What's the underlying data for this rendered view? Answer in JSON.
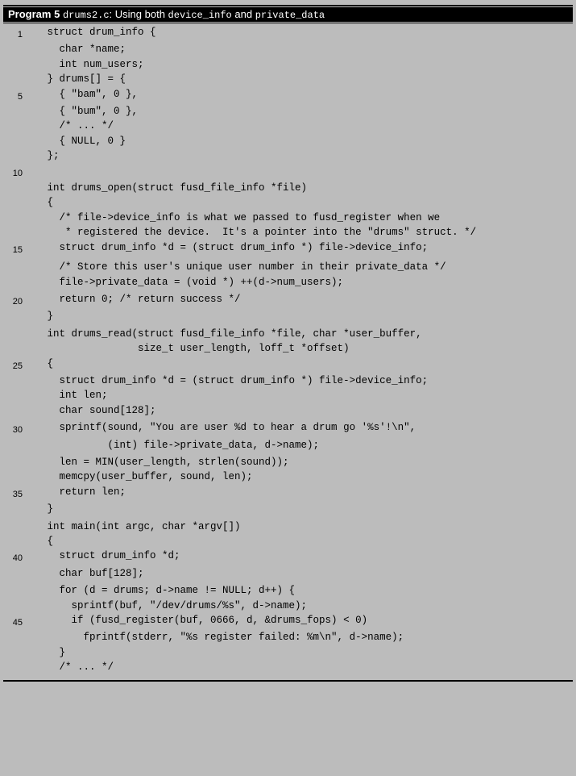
{
  "header": {
    "program_label": "Program 5",
    "filename": "drums2.c",
    "description_prefix": ": Using both ",
    "term1": "device_info",
    "description_mid": " and ",
    "term2": "private_data"
  },
  "code_lines": [
    {
      "num": "1",
      "text": "   struct drum_info {"
    },
    {
      "num": "",
      "text": "     char *name;"
    },
    {
      "num": "",
      "text": "     int num_users;"
    },
    {
      "num": "",
      "text": "   } drums[] = {"
    },
    {
      "num": "5",
      "text": "     { \"bam\", 0 },"
    },
    {
      "num": "",
      "text": "     { \"bum\", 0 },"
    },
    {
      "num": "",
      "text": "     /* ... */"
    },
    {
      "num": "",
      "text": "     { NULL, 0 }"
    },
    {
      "num": "",
      "text": "   };"
    },
    {
      "num": "10",
      "text": ""
    },
    {
      "num": "",
      "text": "   int drums_open(struct fusd_file_info *file)"
    },
    {
      "num": "",
      "text": "   {"
    },
    {
      "num": "",
      "text": "     /* file->device_info is what we passed to fusd_register when we"
    },
    {
      "num": "",
      "text": "      * registered the device.  It's a pointer into the \"drums\" struct. */"
    },
    {
      "num": "15",
      "text": "     struct drum_info *d = (struct drum_info *) file->device_info;"
    },
    {
      "num": "",
      "text": ""
    },
    {
      "num": "",
      "text": "     /* Store this user's unique user number in their private_data */"
    },
    {
      "num": "",
      "text": "     file->private_data = (void *) ++(d->num_users);"
    },
    {
      "num": "",
      "text": ""
    },
    {
      "num": "20",
      "text": "     return 0; /* return success */"
    },
    {
      "num": "",
      "text": "   }"
    },
    {
      "num": "",
      "text": ""
    },
    {
      "num": "",
      "text": "   int drums_read(struct fusd_file_info *file, char *user_buffer,"
    },
    {
      "num": "",
      "text": "                  size_t user_length, loff_t *offset)"
    },
    {
      "num": "25",
      "text": "   {"
    },
    {
      "num": "",
      "text": "     struct drum_info *d = (struct drum_info *) file->device_info;"
    },
    {
      "num": "",
      "text": "     int len;"
    },
    {
      "num": "",
      "text": "     char sound[128];"
    },
    {
      "num": "",
      "text": ""
    },
    {
      "num": "30",
      "text": "     sprintf(sound, \"You are user %d to hear a drum go '%s'!\\n\","
    },
    {
      "num": "",
      "text": "             (int) file->private_data, d->name);"
    },
    {
      "num": "",
      "text": ""
    },
    {
      "num": "",
      "text": "     len = MIN(user_length, strlen(sound));"
    },
    {
      "num": "",
      "text": "     memcpy(user_buffer, sound, len);"
    },
    {
      "num": "35",
      "text": "     return len;"
    },
    {
      "num": "",
      "text": "   }"
    },
    {
      "num": "",
      "text": ""
    },
    {
      "num": "",
      "text": "   int main(int argc, char *argv[])"
    },
    {
      "num": "",
      "text": "   {"
    },
    {
      "num": "40",
      "text": "     struct drum_info *d;"
    },
    {
      "num": "",
      "text": "     char buf[128];"
    },
    {
      "num": "",
      "text": ""
    },
    {
      "num": "",
      "text": "     for (d = drums; d->name != NULL; d++) {"
    },
    {
      "num": "",
      "text": "       sprintf(buf, \"/dev/drums/%s\", d->name);"
    },
    {
      "num": "45",
      "text": "       if (fusd_register(buf, 0666, d, &drums_fops) < 0)"
    },
    {
      "num": "",
      "text": "         fprintf(stderr, \"%s register failed: %m\\n\", d->name);"
    },
    {
      "num": "",
      "text": "     }"
    },
    {
      "num": "",
      "text": "     /* ... */"
    }
  ]
}
